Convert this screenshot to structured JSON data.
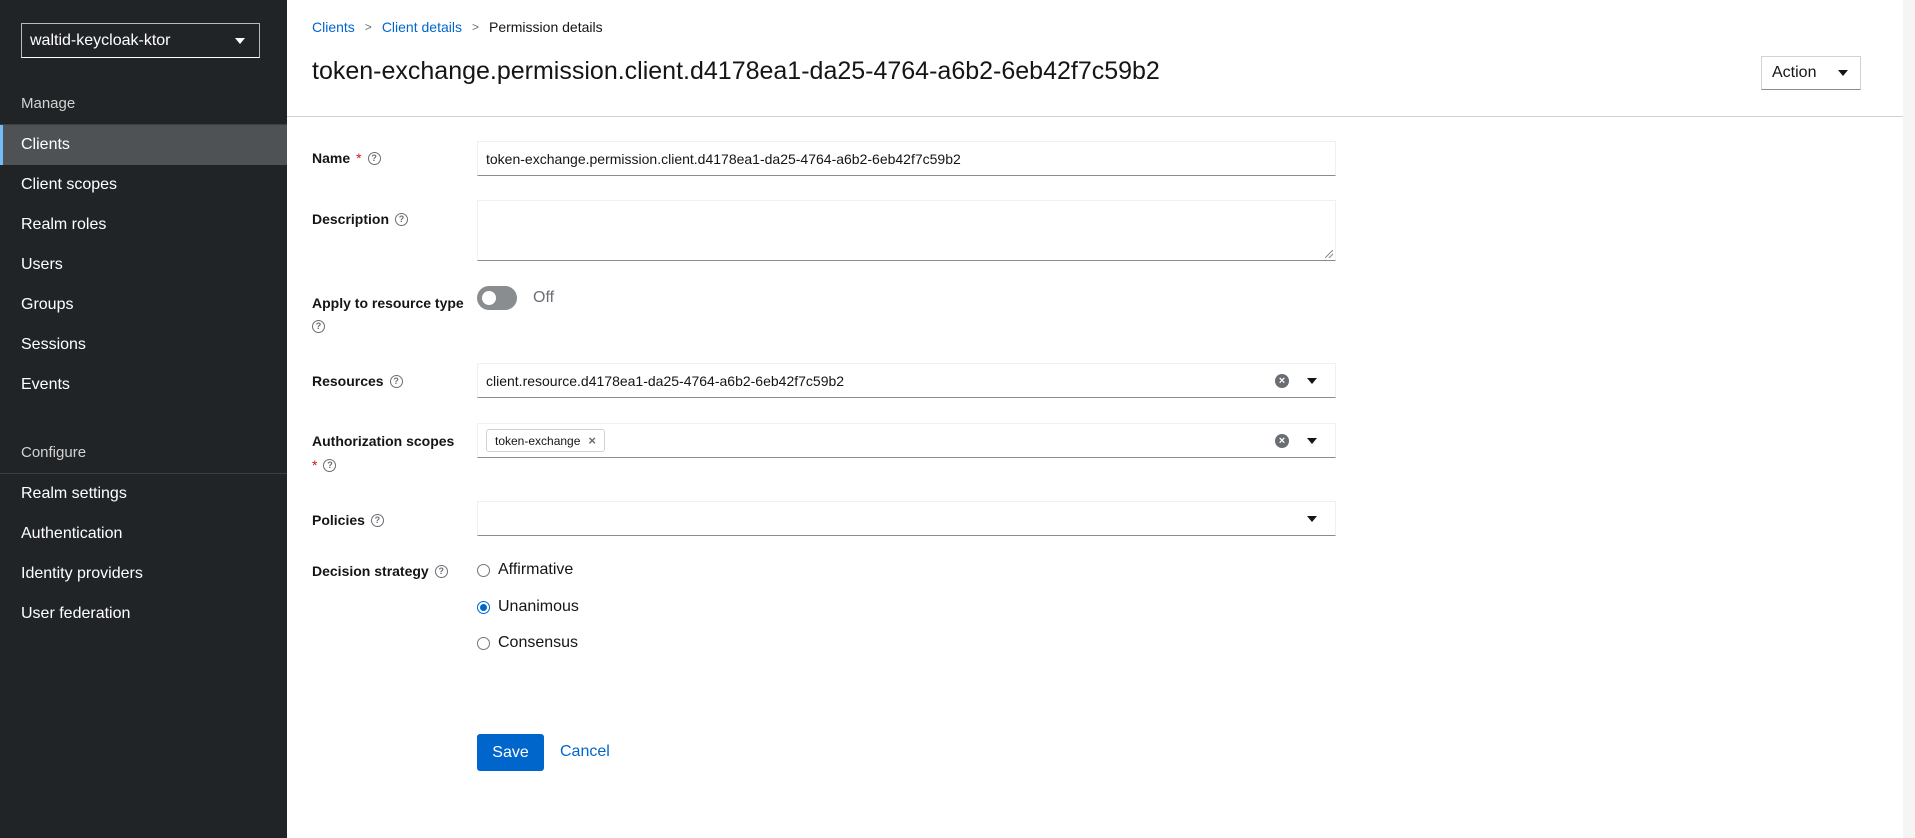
{
  "sidebar": {
    "realm_selector": "waltid-keycloak-ktor",
    "manage_title": "Manage",
    "manage_items": [
      {
        "label": "Clients",
        "active": true
      },
      {
        "label": "Client scopes"
      },
      {
        "label": "Realm roles"
      },
      {
        "label": "Users"
      },
      {
        "label": "Groups"
      },
      {
        "label": "Sessions"
      },
      {
        "label": "Events"
      }
    ],
    "configure_title": "Configure",
    "configure_items": [
      {
        "label": "Realm settings"
      },
      {
        "label": "Authentication"
      },
      {
        "label": "Identity providers"
      },
      {
        "label": "User federation"
      }
    ]
  },
  "breadcrumb": {
    "items": [
      "Clients",
      "Client details",
      "Permission details"
    ],
    "separator": ">"
  },
  "header": {
    "title": "token-exchange.permission.client.d4178ea1-da25-4764-a6b2-6eb42f7c59b2",
    "action_label": "Action"
  },
  "form": {
    "name": {
      "label": "Name",
      "required_mark": "*",
      "value": "token-exchange.permission.client.d4178ea1-da25-4764-a6b2-6eb42f7c59b2"
    },
    "description": {
      "label": "Description",
      "value": ""
    },
    "apply_to_resource_type": {
      "label": "Apply to resource type",
      "state_label": "Off",
      "on": false
    },
    "resources": {
      "label": "Resources",
      "value": "client.resource.d4178ea1-da25-4764-a6b2-6eb42f7c59b2"
    },
    "authorization_scopes": {
      "label": "Authorization scopes",
      "required_mark": "*",
      "chips": [
        "token-exchange"
      ]
    },
    "policies": {
      "label": "Policies",
      "value": ""
    },
    "decision_strategy": {
      "label": "Decision strategy",
      "options": [
        "Affirmative",
        "Unanimous",
        "Consensus"
      ],
      "selected": "Unanimous"
    },
    "save_label": "Save",
    "cancel_label": "Cancel"
  },
  "icons": {
    "help": "help-icon",
    "clear": "clear-icon",
    "caret": "caret-down-icon",
    "chip_remove": "close-icon"
  },
  "colors": {
    "sidebar_bg": "#212427",
    "active_nav_bg": "#4f5255",
    "primary": "#0066cc",
    "required": "#c9190b"
  }
}
